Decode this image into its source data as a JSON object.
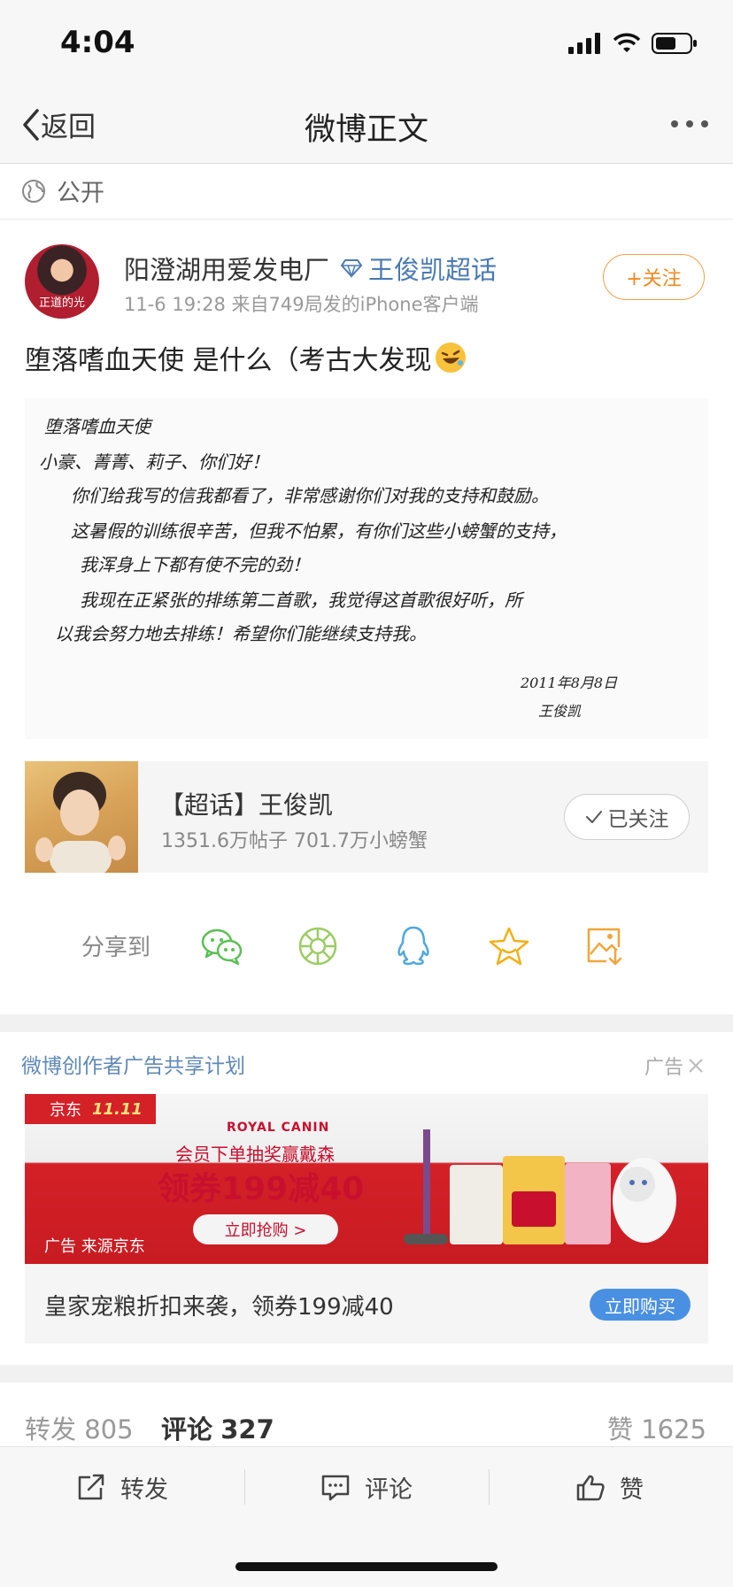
{
  "status_bar": {
    "time": "4:04"
  },
  "nav": {
    "back_label": "返回",
    "title": "微博正文"
  },
  "visibility": {
    "label": "公开"
  },
  "post": {
    "author": "阳澄湖用爱发电厂",
    "super_topic_link": "王俊凯超话",
    "meta": "11-6 19:28  来自749局发的iPhone客户端",
    "follow_label": "+关注",
    "text": "堕落嗜血天使 是什么（考古大发现",
    "avatar_caption": "正道的光"
  },
  "letter": {
    "lines": [
      "堕落嗜血天使",
      "小豪、菁菁、莉子、你们好！",
      "你们给我写的信我都看了，非常感谢你们对我的支持和鼓励。",
      "这暑假的训练很辛苦，但我不怕累，有你们这些小螃蟹的支持，",
      "我浑身上下都有使不完的劲！",
      "我现在正紧张的排练第二首歌，我觉得这首歌很好听，所",
      "以我会努力地去排练！希望你们能继续支持我。",
      "2011年8月8日",
      "王俊凯"
    ]
  },
  "super_topic_card": {
    "title": "【超话】王俊凯",
    "stats": "1351.6万帖子  701.7万小螃蟹",
    "followed_label": "已关注"
  },
  "share": {
    "label": "分享到"
  },
  "ad": {
    "header": "微博创作者广告共享计划",
    "tag": "广告",
    "banner": {
      "platform": "京东",
      "event": "11.11",
      "brand": "ROYAL CANIN",
      "line1": "会员下单抽奖赢戴森",
      "line2": "领券199减40",
      "cta": "立即抢购 >",
      "source": "广告 来源京东"
    },
    "description": "皇家宠粮折扣来袭，领券199减40",
    "buy_label": "立即购买"
  },
  "stats": {
    "repost_label": "转发",
    "repost_count": "805",
    "comment_label": "评论",
    "comment_count": "327",
    "like_label": "赞",
    "like_count": "1625"
  },
  "toolbar": {
    "repost": "转发",
    "comment": "评论",
    "like": "赞"
  },
  "colors": {
    "link_blue": "#4a7ab3",
    "follow_orange": "#f08a1e",
    "ad_red": "#d42027",
    "buy_blue": "#4a90e2"
  }
}
